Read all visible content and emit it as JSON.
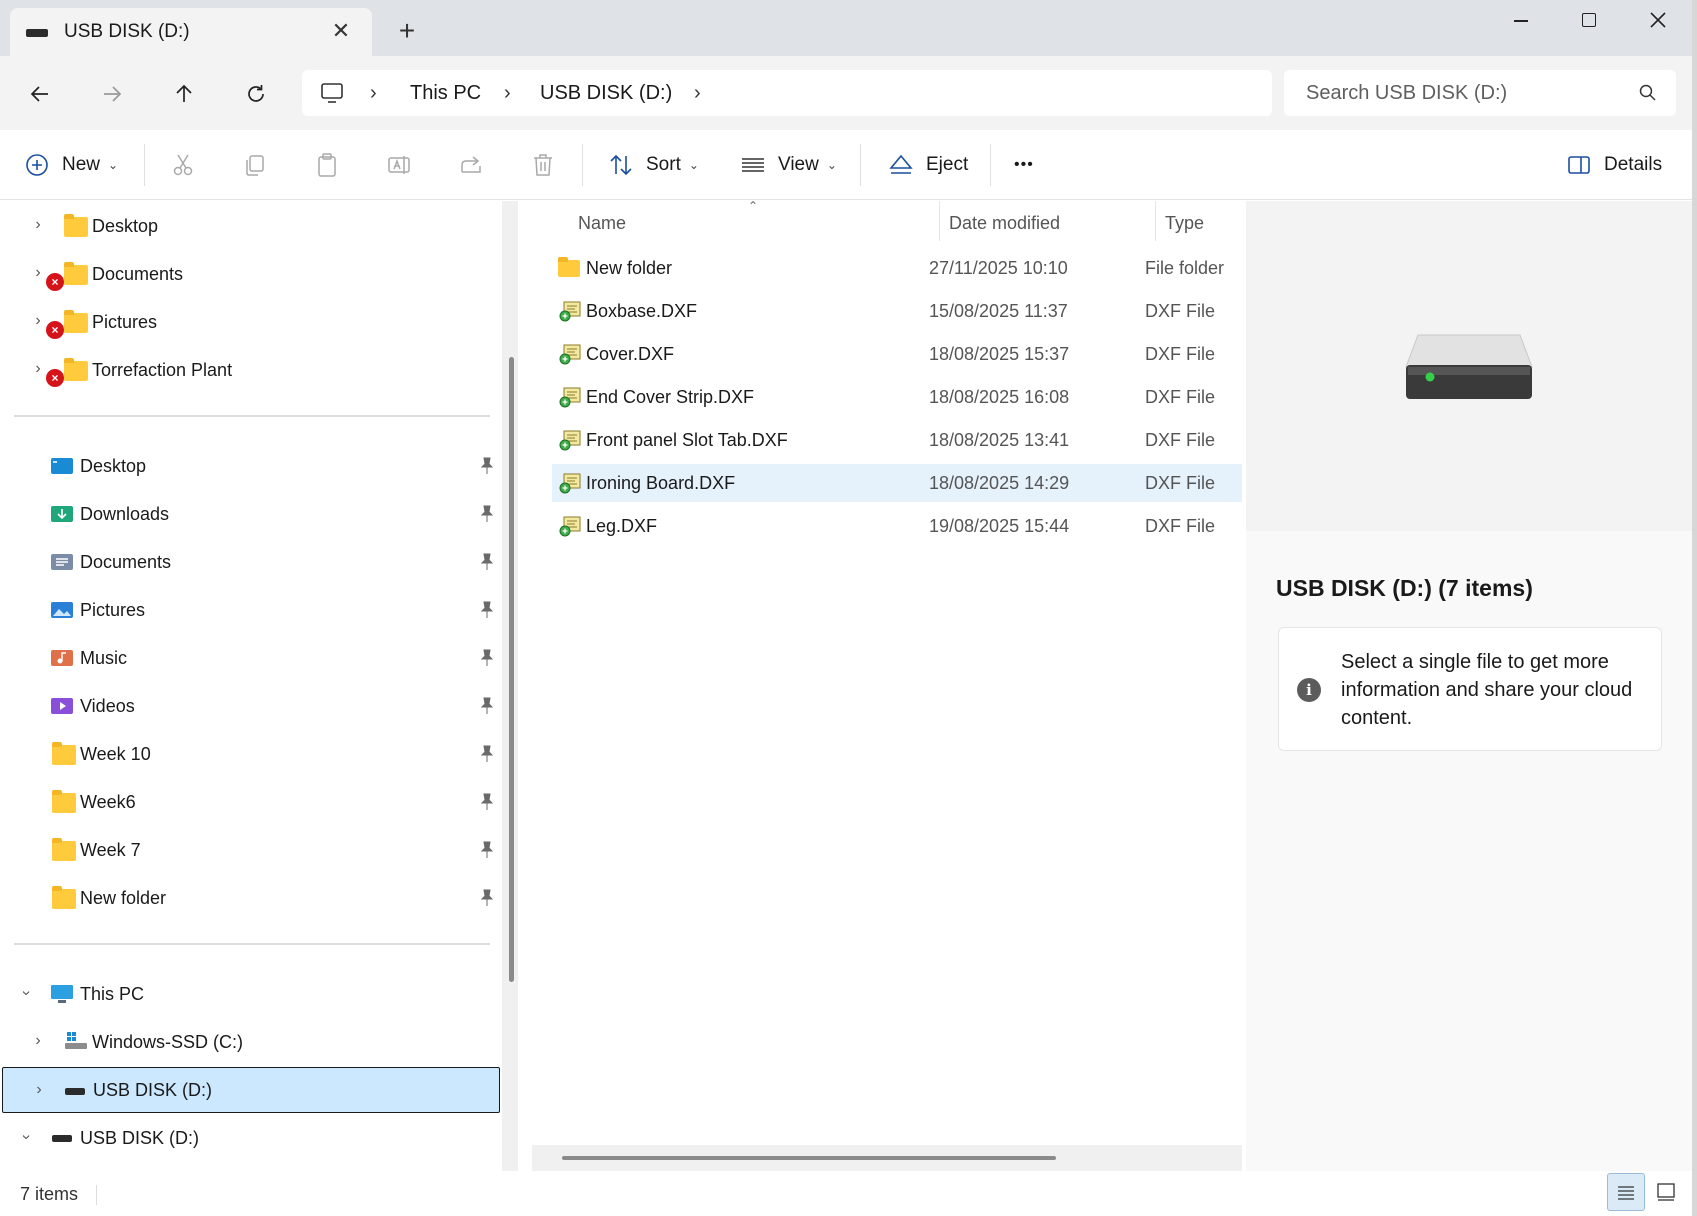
{
  "window": {
    "tab_title": "USB DISK (D:)",
    "tab_close": "✕",
    "new_tab": "+"
  },
  "address": {
    "crumbs": [
      "This PC",
      "USB DISK (D:)"
    ],
    "search_placeholder": "Search USB DISK (D:)"
  },
  "commands": {
    "new": "New",
    "sort": "Sort",
    "view": "View",
    "eject": "Eject",
    "more": "•••",
    "details": "Details"
  },
  "nav": {
    "top_items": [
      {
        "label": "Desktop",
        "error": false
      },
      {
        "label": "Documents",
        "error": true
      },
      {
        "label": "Pictures",
        "error": true
      },
      {
        "label": "Torrefaction Plant",
        "error": true
      }
    ],
    "quick_access": [
      {
        "label": "Desktop",
        "icon": "desktop-folder-icon"
      },
      {
        "label": "Downloads",
        "icon": "downloads-folder-icon"
      },
      {
        "label": "Documents",
        "icon": "documents-folder-icon"
      },
      {
        "label": "Pictures",
        "icon": "pictures-folder-icon"
      },
      {
        "label": "Music",
        "icon": "music-folder-icon"
      },
      {
        "label": "Videos",
        "icon": "videos-folder-icon"
      },
      {
        "label": "Week 10",
        "icon": "folder-icon"
      },
      {
        "label": "Week6",
        "icon": "folder-icon"
      },
      {
        "label": "Week 7",
        "icon": "folder-icon"
      },
      {
        "label": "New folder",
        "icon": "folder-icon"
      }
    ],
    "this_pc": "This PC",
    "drive_c": "Windows-SSD (C:)",
    "drive_d": "USB DISK (D:)",
    "drive_d2": "USB DISK (D:)"
  },
  "files": {
    "headers": {
      "name": "Name",
      "date": "Date modified",
      "type": "Type"
    },
    "rows": [
      {
        "name": "New folder",
        "date": "27/11/2025 10:10",
        "type": "File folder",
        "icon": "folder-icon"
      },
      {
        "name": "Boxbase.DXF",
        "date": "15/08/2025 11:37",
        "type": "DXF File",
        "icon": "dxf-file-icon"
      },
      {
        "name": "Cover.DXF",
        "date": "18/08/2025 15:37",
        "type": "DXF File",
        "icon": "dxf-file-icon"
      },
      {
        "name": "End Cover Strip.DXF",
        "date": "18/08/2025 16:08",
        "type": "DXF File",
        "icon": "dxf-file-icon"
      },
      {
        "name": "Front panel Slot Tab.DXF",
        "date": "18/08/2025 13:41",
        "type": "DXF File",
        "icon": "dxf-file-icon"
      },
      {
        "name": "Ironing Board.DXF",
        "date": "18/08/2025 14:29",
        "type": "DXF File",
        "icon": "dxf-file-icon",
        "selected": true
      },
      {
        "name": "Leg.DXF",
        "date": "19/08/2025 15:44",
        "type": "DXF File",
        "icon": "dxf-file-icon"
      }
    ]
  },
  "details": {
    "title": "USB DISK (D:) (7 items)",
    "message": "Select a single file to get more information and share your cloud content.",
    "info_glyph": "i"
  },
  "status": {
    "count": "7 items"
  },
  "colors": {
    "accent": "#0067c0",
    "selection": "#cce8ff",
    "row_selected": "#e5f1fb",
    "error": "#d4141a",
    "folder": "#ffcb3d"
  }
}
